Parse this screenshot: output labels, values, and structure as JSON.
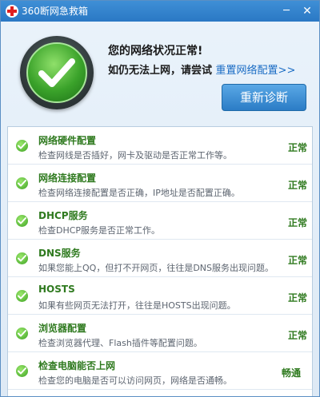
{
  "window": {
    "title": "360断网急救箱",
    "minimize": "─",
    "close": "✕"
  },
  "header": {
    "status": "您的网络状况正常!",
    "prompt": "如仍无法上网，请尝试",
    "reset_link": "重置网络配置>>",
    "rediagnose_label": "重新诊断",
    "badge_icon": "check-icon",
    "accent": "#2b7cc6"
  },
  "checks": [
    {
      "name": "网络硬件配置",
      "desc": "检查网线是否插好，网卡及驱动是否正常工作等。",
      "state": "正常"
    },
    {
      "name": "网络连接配置",
      "desc": "检查网络连接配置是否正确，IP地址是否配置正确。",
      "state": "正常"
    },
    {
      "name": "DHCP服务",
      "desc": "检查DHCP服务是否正常工作。",
      "state": "正常"
    },
    {
      "name": "DNS服务",
      "desc": "如果您能上QQ，但打不开网页，往往是DNS服务出现问题。",
      "state": "正常"
    },
    {
      "name": "HOSTS",
      "desc": "如果有些网页无法打开，往往是HOSTS出现问题。",
      "state": "正常"
    },
    {
      "name": "浏览器配置",
      "desc": "检查浏览器代理、Flash插件等配置问题。",
      "state": "正常"
    },
    {
      "name": "检查电脑能否上网",
      "desc": "检查您的电脑是否可以访问网页，网络是否通畅。",
      "state": "畅通"
    }
  ],
  "colors": {
    "ok_green": "#2f7a1f",
    "title_blue": "#2a78c4"
  }
}
